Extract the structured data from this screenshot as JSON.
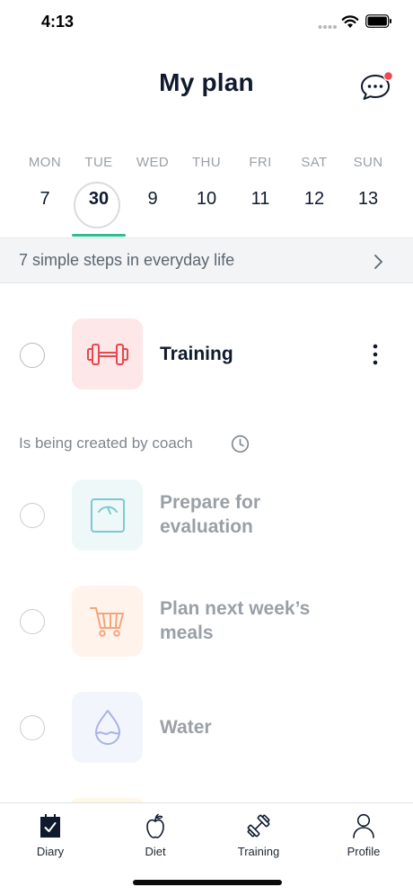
{
  "status_bar": {
    "time": "4:13"
  },
  "header": {
    "title": "My plan"
  },
  "week": {
    "days": [
      {
        "name": "MON",
        "num": "7"
      },
      {
        "name": "TUE",
        "num": "30",
        "selected": true
      },
      {
        "name": "WED",
        "num": "9"
      },
      {
        "name": "THU",
        "num": "10"
      },
      {
        "name": "FRI",
        "num": "11"
      },
      {
        "name": "SAT",
        "num": "12"
      },
      {
        "name": "SUN",
        "num": "13"
      }
    ]
  },
  "steps_banner": {
    "text": "7 simple steps in everyday life"
  },
  "tasks": {
    "training": {
      "label": "Training",
      "icon": "dumbbell-icon",
      "icon_bg": "#fde7e8",
      "icon_color": "#e5484d"
    },
    "section_label": "Is being created by coach",
    "evaluation": {
      "line1": "Prepare for",
      "line2": "evaluation",
      "icon": "scale-icon",
      "icon_bg": "#eef8f8",
      "icon_color": "#7ec9d0"
    },
    "meals": {
      "line1": "Plan next week’s",
      "line2": "meals",
      "icon": "cart-icon",
      "icon_bg": "#fff3ec",
      "icon_color": "#f4a57a"
    },
    "water": {
      "label": "Water",
      "icon": "water-drop-icon",
      "icon_bg": "#f3f5fd",
      "icon_color": "#a9b3e6"
    }
  },
  "bottom_nav": {
    "items": [
      {
        "label": "Diary",
        "icon": "diary-icon"
      },
      {
        "label": "Diet",
        "icon": "apple-icon"
      },
      {
        "label": "Training",
        "icon": "dumbbell-icon"
      },
      {
        "label": "Profile",
        "icon": "person-icon"
      }
    ]
  },
  "colors": {
    "accent": "#2fbe8f",
    "notification": "#f0494f",
    "text_dark": "#0f1a2e",
    "text_muted": "#9aa0a6"
  }
}
